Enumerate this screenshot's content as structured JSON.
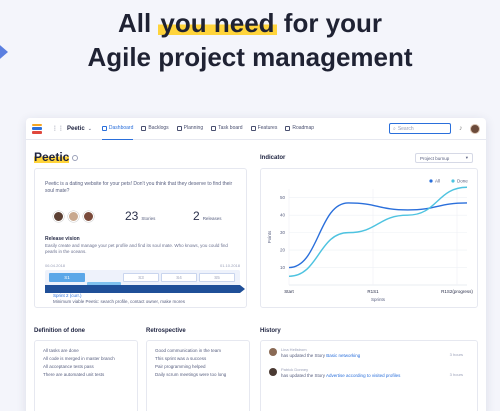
{
  "hero": {
    "pre": "All ",
    "highlight": "you need",
    "post": " for your",
    "line2": "Agile project management"
  },
  "nav": {
    "project": "Peetic",
    "items": [
      {
        "label": "Dashboard",
        "active": true
      },
      {
        "label": "Backlogs",
        "active": false
      },
      {
        "label": "Planning",
        "active": false
      },
      {
        "label": "Task board",
        "active": false
      },
      {
        "label": "Features",
        "active": false
      },
      {
        "label": "Roadmap",
        "active": false
      }
    ],
    "search_placeholder": "Search"
  },
  "overview": {
    "title": "Peetic",
    "description": "Peetic is a dating website for your pets! Don't you think that they deserve to find their soul mate?",
    "stories_count": "23",
    "stories_label": "Stories",
    "releases_count": "2",
    "releases_label": "Releases",
    "release_vision_label": "Release vision",
    "release_vision_text": "Easily create and manage your pet profile and find its soul mate. Who knows, you could find pearls in the oceans.",
    "start_date": "06.04.2018",
    "end_date": "01.10.2018",
    "sprints": [
      {
        "label": "S1",
        "color": "#5ba7e8"
      },
      {
        "label": "S2",
        "color": "#7fc1ee"
      },
      {
        "label": "S3",
        "color": "#ffffff"
      },
      {
        "label": "S4",
        "color": "#ffffff"
      },
      {
        "label": "S5",
        "color": "#ffffff"
      }
    ],
    "sprint_label": "Sprint 2 (curr.)",
    "sprint_desc": "Minimum viable Peetic: search profile, contact owner, make mores"
  },
  "indicator": {
    "title": "Indicator",
    "select_label": "Project burnup"
  },
  "chart_data": {
    "type": "line",
    "x": [
      "Start",
      "R1S1",
      "R1S2(progress)"
    ],
    "xlabel": "Sprints",
    "ylabel": "Points",
    "ylim": [
      0,
      55
    ],
    "yticks": [
      10,
      20,
      30,
      40,
      50
    ],
    "legend_position": "top-right",
    "series": [
      {
        "name": "All",
        "color": "#2a6fdb",
        "values": [
          10,
          47,
          43,
          47
        ]
      },
      {
        "name": "Done",
        "color": "#4ec3e0",
        "values": [
          5,
          30,
          40,
          56
        ]
      }
    ]
  },
  "definition_of_done": {
    "title": "Definition of done",
    "items": [
      "All tasks are done",
      "All code is merged in master branch",
      "All acceptance tests pass",
      "There are automated unit tests"
    ]
  },
  "retrospective": {
    "title": "Retrospective",
    "items": [
      "Good communication in the team",
      "This sprint was a success",
      "Pair programming helped",
      "Daily scrum meetings were too long"
    ]
  },
  "history": {
    "title": "History",
    "entries": [
      {
        "who": "Lina Hellstrom",
        "text": "has updated the Story",
        "link": "Basic networking",
        "time": "3 hours",
        "avatar_color": "#8a6a55"
      },
      {
        "who": "Patrick Donney",
        "text": "has updated the Story",
        "link": "Advertise according to visited profiles",
        "time": "3 hours",
        "avatar_color": "#4a3a33"
      }
    ]
  }
}
